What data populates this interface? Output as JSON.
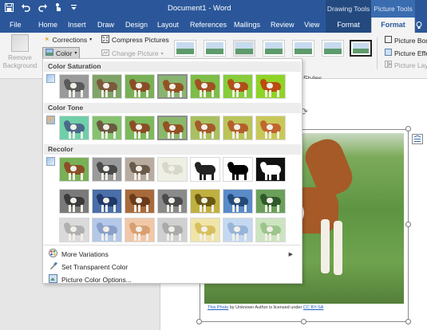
{
  "titlebar": {
    "doc_title": "Document1  -  Word",
    "contextual_drawing": "Drawing Tools",
    "contextual_picture": "Picture Tools"
  },
  "tabs": [
    "File",
    "Home",
    "Insert",
    "Draw",
    "Design",
    "Layout",
    "References",
    "Mailings",
    "Review",
    "View"
  ],
  "context_tabs": {
    "drawing_format": "Format",
    "picture_format": "Format"
  },
  "ribbon": {
    "remove_background": "Remove Background",
    "corrections": "Corrections",
    "color": "Color",
    "compress_pictures": "Compress Pictures",
    "change_picture": "Change Picture",
    "picture_border": "Picture Borde",
    "picture_effects": "Picture Effec",
    "picture_layout": "Picture Layo",
    "styles_group": "Styles"
  },
  "dropdown": {
    "section_saturation": "Color Saturation",
    "section_tone": "Color Tone",
    "section_recolor": "Recolor",
    "more_variations": "More Variations",
    "set_transparent": "Set Transparent Color",
    "picture_color_options": "Picture Color Options..."
  },
  "caption": {
    "link1": "This Photo",
    "middle": " by Unknown Author is licensed under ",
    "link2": "CC BY-SA"
  },
  "colors": {
    "word_blue": "#2b579a",
    "contextual_dark": "#23497f",
    "ribbon_bg": "#f3f3f3",
    "link_blue": "#1a5fc4"
  },
  "icons": [
    "save-icon",
    "undo-icon",
    "redo-icon",
    "touch-mode-icon",
    "customize-qat-icon",
    "lightbulb-icon",
    "corrections-icon",
    "color-icon",
    "compress-icon",
    "change-picture-icon",
    "picture-border-icon",
    "picture-effects-icon",
    "picture-layout-icon",
    "layout-options-icon",
    "rotate-icon"
  ]
}
